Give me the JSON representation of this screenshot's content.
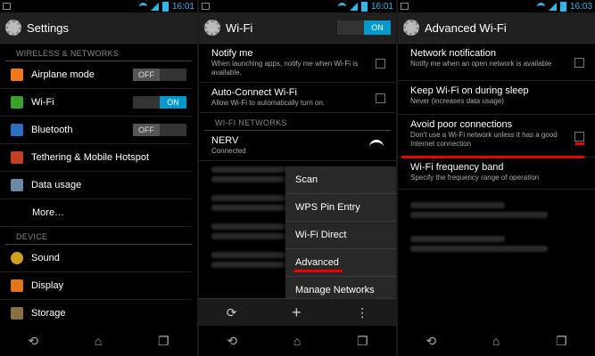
{
  "status": {
    "time1": "16:01",
    "time2": "16:01",
    "time3": "16:03"
  },
  "screen1": {
    "title": "Settings",
    "section_wireless": "WIRELESS & NETWORKS",
    "items": [
      {
        "label": "Airplane mode",
        "icon": "airplane-icon",
        "color": "#f07a1a",
        "toggle": "OFF"
      },
      {
        "label": "Wi-Fi",
        "icon": "wifi-icon",
        "color": "#3aa02a",
        "toggle": "ON"
      },
      {
        "label": "Bluetooth",
        "icon": "bluetooth-icon",
        "color": "#2a6fc0",
        "toggle": "OFF"
      },
      {
        "label": "Tethering & Mobile Hotspot",
        "icon": "hotspot-icon",
        "color": "#c04020"
      },
      {
        "label": "Data usage",
        "icon": "data-usage-icon",
        "color": "#6b8aa8"
      },
      {
        "label": "More…"
      }
    ],
    "section_device": "DEVICE",
    "device_items": [
      {
        "label": "Sound",
        "icon": "sound-icon",
        "color": "#d0a020"
      },
      {
        "label": "Display",
        "icon": "display-icon",
        "color": "#e0761a"
      },
      {
        "label": "Storage",
        "icon": "storage-icon",
        "color": "#8a7040"
      }
    ]
  },
  "screen2": {
    "title": "Wi-Fi",
    "master_toggle": "ON",
    "notify_title": "Notify me",
    "notify_summary": "When launching apps, notify me when Wi-Fi is available.",
    "autoconnect_title": "Auto-Connect Wi-Fi",
    "autoconnect_summary": "Allow Wi-Fi to automatically turn on.",
    "section_networks": "WI-FI NETWORKS",
    "network_name": "NERV",
    "network_status": "Connected",
    "menu": [
      "Scan",
      "WPS Pin Entry",
      "Wi-Fi Direct",
      "Advanced",
      "Manage Networks"
    ]
  },
  "screen3": {
    "title": "Advanced Wi-Fi",
    "prefs": [
      {
        "title": "Network notification",
        "summary": "Notify me when an open network is available"
      },
      {
        "title": "Keep Wi-Fi on during sleep",
        "summary": "Never (increases data usage)"
      },
      {
        "title": "Avoid poor connections",
        "summary": "Don't use a Wi-Fi network unless it has a good Internet connection"
      },
      {
        "title": "Wi-Fi frequency band",
        "summary": "Specify the frequency range of operation"
      }
    ],
    "colors": {
      "accent": "#33b5e5",
      "toggle_on": "#0099cc",
      "highlight": "#e00000"
    }
  }
}
